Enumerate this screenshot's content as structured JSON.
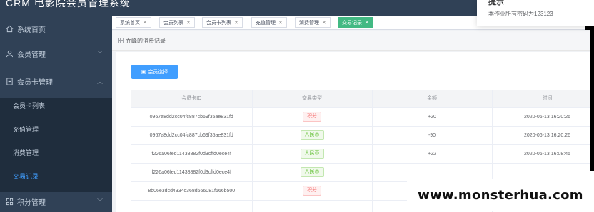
{
  "app": {
    "title": "CRM 电影院会员管理系统"
  },
  "sidebar": {
    "items": [
      {
        "label": "系统首页",
        "icon": "home-icon"
      },
      {
        "label": "会员管理",
        "icon": "user-icon"
      },
      {
        "label": "会员卡管理",
        "icon": "card-icon"
      }
    ],
    "sub_items": [
      {
        "label": "会员卡列表"
      },
      {
        "label": "充值管理"
      },
      {
        "label": "消费管理"
      },
      {
        "label": "交易记录"
      }
    ],
    "bottom_item": {
      "label": "积分管理",
      "icon": "grid-icon"
    },
    "active": "交易记录"
  },
  "tags": [
    {
      "label": "系统首页"
    },
    {
      "label": "会员列表"
    },
    {
      "label": "会员卡列表"
    },
    {
      "label": "充值管理"
    },
    {
      "label": "消费管理"
    },
    {
      "label": "交易记录"
    }
  ],
  "panel": {
    "title": "乔峰的消费记录"
  },
  "toolbar": {
    "select_member_label": "会员选择"
  },
  "table": {
    "headers": [
      "会员卡ID",
      "交易类型",
      "金额",
      "时间"
    ],
    "rows": [
      {
        "id": "0967a8dd2cc04fc887cb69f35ae831fd",
        "type": "积分",
        "type_kind": "pts",
        "amount": "+20",
        "time": "2020-06-13 16:20:26"
      },
      {
        "id": "0967a8dd2cc04fc887cb69f35ae831fd",
        "type": "人民币",
        "type_kind": "rmb",
        "amount": "-90",
        "time": "2020-06-13 16:20:26"
      },
      {
        "id": "f226a06fed11438882f0d3cffd0ece4f",
        "type": "人民币",
        "type_kind": "rmb",
        "amount": "+22",
        "time": "2020-06-13 16:08:45"
      },
      {
        "id": "f226a06fed11438882f0d3cffd0ece4f",
        "type": "人民币",
        "type_kind": "rmb",
        "amount": "",
        "time": ""
      },
      {
        "id": "8b06e3dcd4334c368d666081f666b500",
        "type": "积分",
        "type_kind": "pts",
        "amount": "",
        "time": ""
      },
      {
        "id": "",
        "type": "",
        "type_kind": "pts",
        "amount": "",
        "time": ""
      }
    ]
  },
  "notification": {
    "title": "提示",
    "message": "本作业所有密码为123123"
  },
  "watermark": {
    "text": "www.monsterhua.com"
  },
  "colors": {
    "sidebar": "#304156",
    "submenu": "#1f2d3d",
    "accent": "#409eff",
    "tag_active": "#42b983"
  }
}
